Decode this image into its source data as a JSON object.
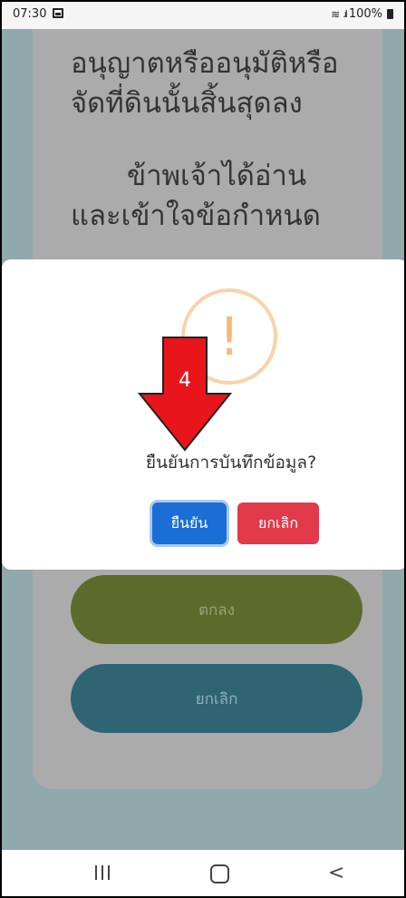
{
  "status_bar": {
    "time": "07:30",
    "battery": "100%",
    "icons": [
      "image-icon",
      "wifi-icon",
      "signal-icon",
      "battery-icon"
    ]
  },
  "background_content": {
    "clause_line_1": "อนุญาตหรืออนุมัติหรือ",
    "clause_line_2": "จัดที่ดินนั้นสิ้นสุดลง",
    "clause_line_3": "ข้าพเจ้าได้อ่าน",
    "clause_line_4": "และเข้าใจข้อกำหนด",
    "ok_label": "ตกลง",
    "cancel_label": "ยกเลิก"
  },
  "dialog": {
    "icon": "warning-icon",
    "icon_glyph": "!",
    "question": "ยืนยันการบันทึกข้อมูล?",
    "confirm_label": "ยืนยัน",
    "cancel_label": "ยกเลิก"
  },
  "annotation": {
    "step_number": "4",
    "arrow_color": "#e8151b"
  },
  "colors": {
    "confirm": "#1b6ed6",
    "cancel": "#e23a4a",
    "ok_background": "#5c6a2c",
    "cancel_background": "#2f6473"
  }
}
